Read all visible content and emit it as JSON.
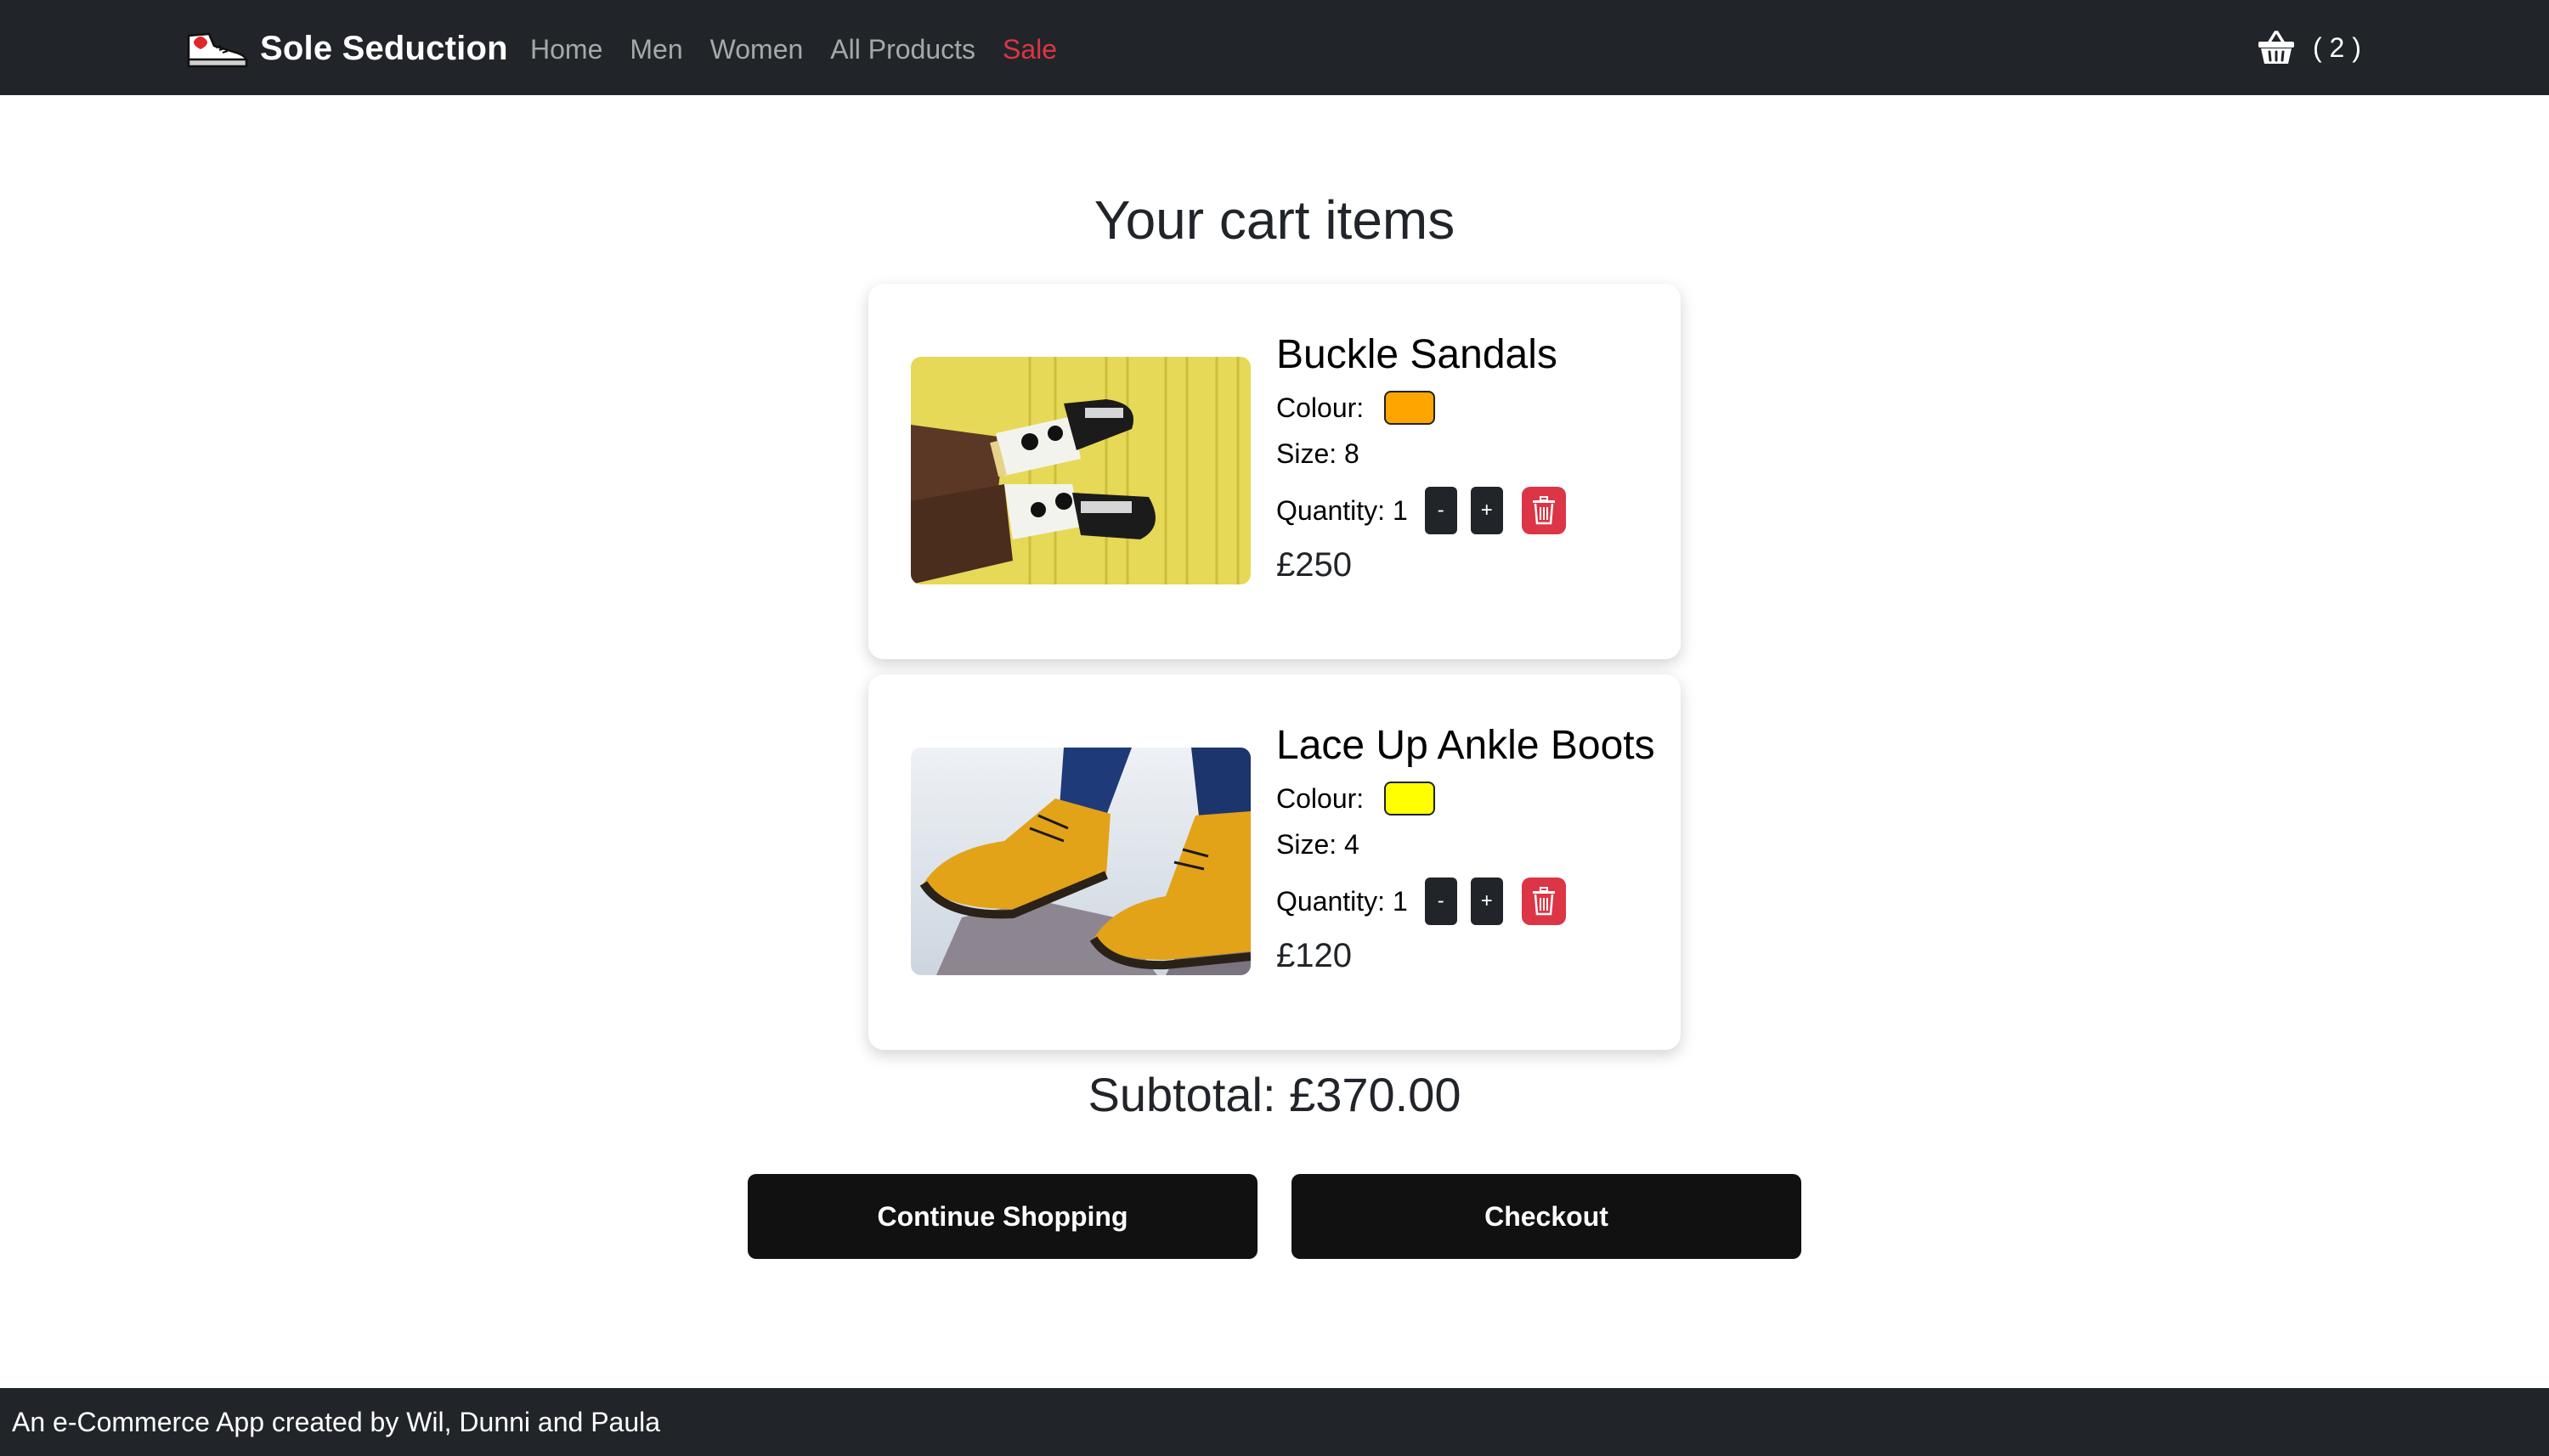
{
  "brand": {
    "name": "Sole Seduction",
    "logo_icon": "sneaker-icon"
  },
  "nav": {
    "links": [
      {
        "label": "Home"
      },
      {
        "label": "Men"
      },
      {
        "label": "Women"
      },
      {
        "label": "All Products"
      },
      {
        "label": "Sale"
      }
    ]
  },
  "cart": {
    "icon": "basket-icon",
    "count_label": "( 2 )"
  },
  "main": {
    "title": "Your cart items"
  },
  "items": [
    {
      "name": "Buckle Sandals",
      "colour_label": "Colour:",
      "colour": "#FFA500",
      "size_label": "Size: 8",
      "quantity_label": "Quantity: 1",
      "minus_label": "-",
      "plus_label": "+",
      "price": "£250"
    },
    {
      "name": "Lace Up Ankle Boots",
      "colour_label": "Colour:",
      "colour": "#FFFF00",
      "size_label": "Size: 4",
      "quantity_label": "Quantity: 1",
      "minus_label": "-",
      "plus_label": "+",
      "price": "£120"
    }
  ],
  "subtotal": "Subtotal: £370.00",
  "actions": {
    "continue_label": "Continue Shopping",
    "checkout_label": "Checkout"
  },
  "footer": {
    "text": "An e-Commerce App created by Wil, Dunni and Paula"
  },
  "colors": {
    "navbar": "#212529",
    "sale": "#DC3545",
    "delete": "#DC3545",
    "button": "#111111"
  }
}
